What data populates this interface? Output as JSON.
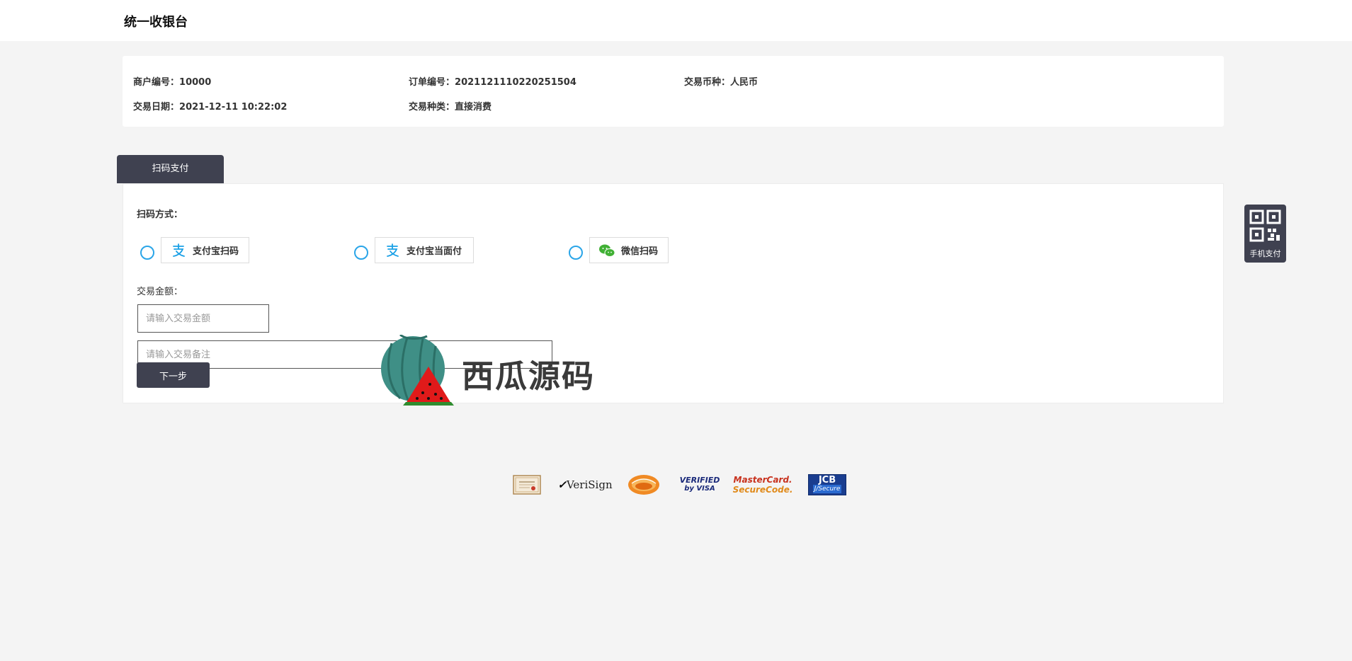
{
  "header": {
    "title": "统一收银台"
  },
  "order_info": {
    "merchant_label": "商户编号",
    "merchant_value": "10000",
    "order_label": "订单编号",
    "order_value": "2021121110220251504",
    "currency_label": "交易币种",
    "currency_value": "人民币",
    "date_label": "交易日期",
    "date_value": "2021-12-11 10:22:02",
    "type_label": "交易种类",
    "type_value": "直接消费",
    "separator": "："
  },
  "tabs": [
    {
      "label": "扫码支付"
    }
  ],
  "payment": {
    "method_label": "扫码方式：",
    "methods": [
      {
        "label": "支付宝扫码",
        "icon": "alipay-icon",
        "color": "#1aa0e6"
      },
      {
        "label": "支付宝当面付",
        "icon": "alipay-icon",
        "color": "#1aa0e6"
      },
      {
        "label": "微信扫码",
        "icon": "wechat-icon",
        "color": "#41b035"
      }
    ],
    "amount_label": "交易金额：",
    "amount_placeholder": "请输入交易金额",
    "remark_placeholder": "请输入交易备注",
    "next_label": "下一步"
  },
  "watermark": {
    "text": "西瓜源码"
  },
  "mobile_pay": {
    "label": "手机支付",
    "icon": "qrcode-icon"
  },
  "footer_logos": [
    {
      "name": "certificate-logo"
    },
    {
      "name": "verisign-logo",
      "text": "VeriSign"
    },
    {
      "name": "cfca-logo"
    },
    {
      "name": "verified-by-visa-logo",
      "text1": "VERIFIED",
      "text2": "by VISA"
    },
    {
      "name": "mastercard-securecode-logo",
      "text1": "MasterCard.",
      "text2": "SecureCode."
    },
    {
      "name": "jcb-jsecure-logo",
      "text1": "JCB",
      "text2": "J/Secure"
    }
  ],
  "colors": {
    "accent_dark": "#3f4150",
    "radio": "#2aa5e8",
    "background": "#f4f4f4"
  }
}
